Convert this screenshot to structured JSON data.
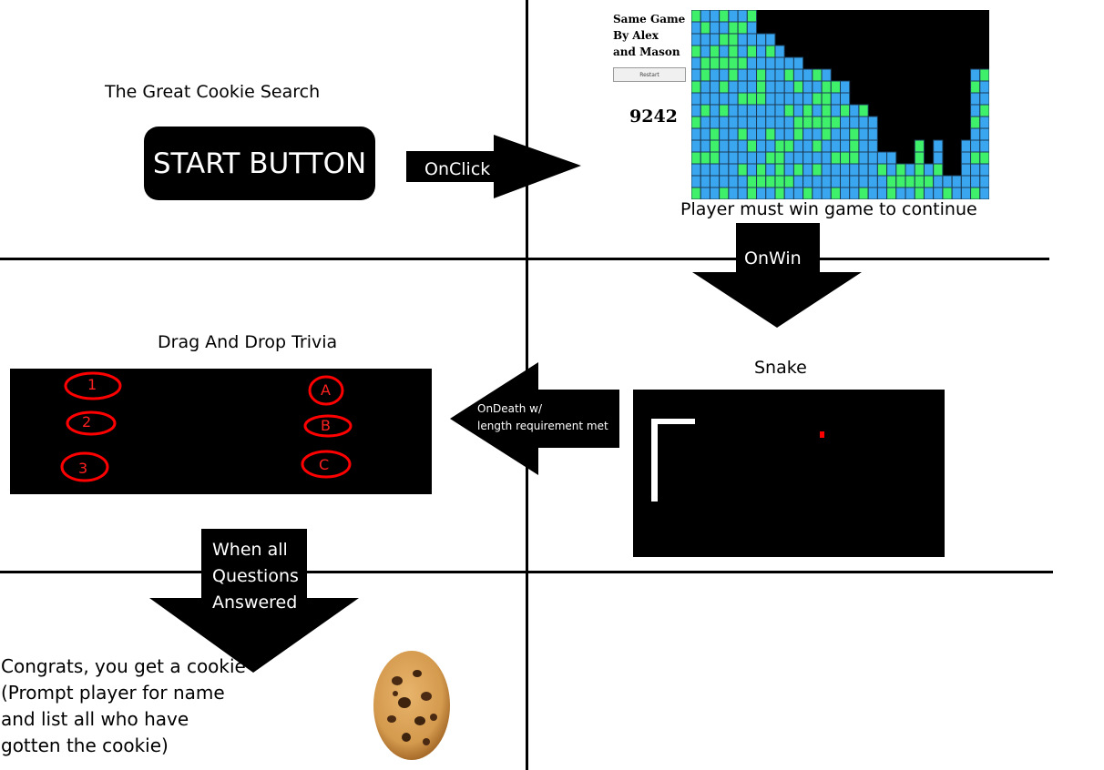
{
  "start": {
    "title": "The Great Cookie Search",
    "button_label": "START BUTTON",
    "arrow_label": "OnClick"
  },
  "same_game": {
    "title_lines": [
      "Same Game",
      "By Alex",
      "and Mason"
    ],
    "restart_label": "Restart",
    "score": "9242",
    "caption": "Player must win game to continue",
    "arrow_label": "OnWin",
    "colors": {
      "green": "#3ef06a",
      "blue": "#3aa6f0",
      "empty": "#000000"
    },
    "column_heights": [
      16,
      16,
      16,
      16,
      16,
      16,
      16,
      14,
      14,
      13,
      12,
      12,
      11,
      11,
      11,
      10,
      10,
      8,
      8,
      7,
      4,
      4,
      3,
      3,
      5,
      3,
      5,
      2,
      2,
      5,
      11,
      11
    ]
  },
  "snake": {
    "title": "Snake",
    "arrow_label_lines": [
      "OnDeath w/",
      "length requirement met"
    ],
    "food_color": "#ff0000",
    "snake_color": "#ffffff"
  },
  "trivia": {
    "title": "Drag And Drop Trivia",
    "questions": [
      "1",
      "2",
      "3"
    ],
    "answers": [
      "A",
      "B",
      "C"
    ],
    "accent": "#ff0000",
    "arrow_label_lines": [
      "When all",
      "Questions",
      "Answered"
    ]
  },
  "final": {
    "lines": [
      "Congrats, you get a cookie",
      "(Prompt player for name",
      "and list all who have",
      "gotten the cookie)"
    ]
  }
}
